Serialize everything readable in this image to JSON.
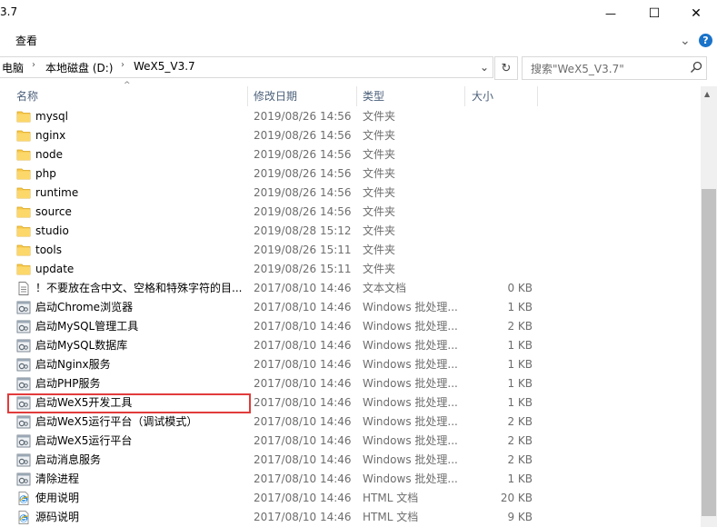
{
  "window": {
    "title_fragment": "3.7",
    "minimize_glyph": "—",
    "maximize_glyph": "☐",
    "close_glyph": "✕"
  },
  "ribbon": {
    "tab_view": "查看",
    "expand_glyph": "⌄",
    "help_glyph": "?"
  },
  "address": {
    "crumbs": [
      "电脑",
      "本地磁盘 (D:)",
      "WeX5_V3.7"
    ],
    "separator": "›",
    "dropdown_glyph": "⌄",
    "refresh_glyph": "↻"
  },
  "search": {
    "placeholder": "搜索\"WeX5_V3.7\""
  },
  "columns": {
    "name": "名称",
    "date": "修改日期",
    "type": "类型",
    "size": "大小",
    "sort_glyph": "^"
  },
  "files": [
    {
      "name": "mysql",
      "date": "2019/08/26 14:56",
      "type": "文件夹",
      "size": "",
      "icon": "folder-icon"
    },
    {
      "name": "nginx",
      "date": "2019/08/26 14:56",
      "type": "文件夹",
      "size": "",
      "icon": "folder-icon"
    },
    {
      "name": "node",
      "date": "2019/08/26 14:56",
      "type": "文件夹",
      "size": "",
      "icon": "folder-icon"
    },
    {
      "name": "php",
      "date": "2019/08/26 14:56",
      "type": "文件夹",
      "size": "",
      "icon": "folder-icon"
    },
    {
      "name": "runtime",
      "date": "2019/08/26 14:56",
      "type": "文件夹",
      "size": "",
      "icon": "folder-icon"
    },
    {
      "name": "source",
      "date": "2019/08/26 14:56",
      "type": "文件夹",
      "size": "",
      "icon": "folder-icon"
    },
    {
      "name": "studio",
      "date": "2019/08/28 15:12",
      "type": "文件夹",
      "size": "",
      "icon": "folder-icon"
    },
    {
      "name": "tools",
      "date": "2019/08/26 15:11",
      "type": "文件夹",
      "size": "",
      "icon": "folder-icon"
    },
    {
      "name": "update",
      "date": "2019/08/26 15:11",
      "type": "文件夹",
      "size": "",
      "icon": "folder-icon"
    },
    {
      "name": "！不要放在含中文、空格和特殊字符的目...",
      "date": "2017/08/10 14:46",
      "type": "文本文档",
      "size": "0 KB",
      "icon": "text-file-icon"
    },
    {
      "name": "启动Chrome浏览器",
      "date": "2017/08/10 14:46",
      "type": "Windows 批处理...",
      "size": "1 KB",
      "icon": "batch-file-icon"
    },
    {
      "name": "启动MySQL管理工具",
      "date": "2017/08/10 14:46",
      "type": "Windows 批处理...",
      "size": "2 KB",
      "icon": "batch-file-icon"
    },
    {
      "name": "启动MySQL数据库",
      "date": "2017/08/10 14:46",
      "type": "Windows 批处理...",
      "size": "1 KB",
      "icon": "batch-file-icon"
    },
    {
      "name": "启动Nginx服务",
      "date": "2017/08/10 14:46",
      "type": "Windows 批处理...",
      "size": "1 KB",
      "icon": "batch-file-icon"
    },
    {
      "name": "启动PHP服务",
      "date": "2017/08/10 14:46",
      "type": "Windows 批处理...",
      "size": "1 KB",
      "icon": "batch-file-icon"
    },
    {
      "name": "启动WeX5开发工具",
      "date": "2017/08/10 14:46",
      "type": "Windows 批处理...",
      "size": "1 KB",
      "icon": "batch-file-icon",
      "highlighted": true
    },
    {
      "name": "启动WeX5运行平台（调试模式）",
      "date": "2017/08/10 14:46",
      "type": "Windows 批处理...",
      "size": "2 KB",
      "icon": "batch-file-icon"
    },
    {
      "name": "启动WeX5运行平台",
      "date": "2017/08/10 14:46",
      "type": "Windows 批处理...",
      "size": "2 KB",
      "icon": "batch-file-icon"
    },
    {
      "name": "启动消息服务",
      "date": "2017/08/10 14:46",
      "type": "Windows 批处理...",
      "size": "2 KB",
      "icon": "batch-file-icon"
    },
    {
      "name": "清除进程",
      "date": "2017/08/10 14:46",
      "type": "Windows 批处理...",
      "size": "1 KB",
      "icon": "batch-file-icon"
    },
    {
      "name": "使用说明",
      "date": "2017/08/10 14:46",
      "type": "HTML 文档",
      "size": "20 KB",
      "icon": "html-file-icon"
    },
    {
      "name": "源码说明",
      "date": "2017/08/10 14:46",
      "type": "HTML 文档",
      "size": "9 KB",
      "icon": "html-file-icon"
    }
  ],
  "colors": {
    "highlight": "#e23b3b",
    "folder": "#f7c94b",
    "header_text": "#4c607a",
    "muted_text": "#6d6d6d"
  }
}
